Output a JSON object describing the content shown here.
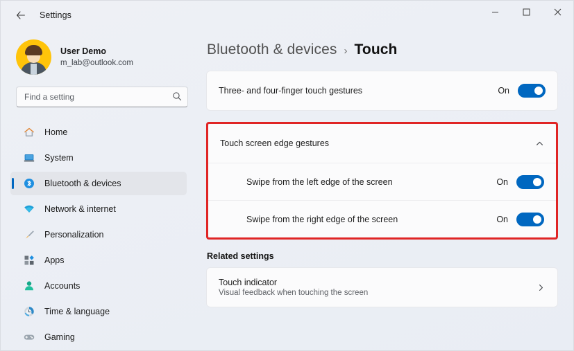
{
  "window": {
    "app_title": "Settings",
    "back_icon": "back-arrow-icon",
    "minimize_label": "—",
    "maximize_label": "□",
    "close_label": "✕"
  },
  "sidebar": {
    "profile": {
      "name": "User Demo",
      "email": "m_lab@outlook.com"
    },
    "search": {
      "placeholder": "Find a setting",
      "value": ""
    },
    "items": [
      {
        "label": "Home",
        "icon": "home-icon",
        "active": false
      },
      {
        "label": "System",
        "icon": "system-icon",
        "active": false
      },
      {
        "label": "Bluetooth & devices",
        "icon": "bluetooth-icon",
        "active": true
      },
      {
        "label": "Network & internet",
        "icon": "network-icon",
        "active": false
      },
      {
        "label": "Personalization",
        "icon": "brush-icon",
        "active": false
      },
      {
        "label": "Apps",
        "icon": "apps-icon",
        "active": false
      },
      {
        "label": "Accounts",
        "icon": "accounts-icon",
        "active": false
      },
      {
        "label": "Time & language",
        "icon": "clock-icon",
        "active": false
      },
      {
        "label": "Gaming",
        "icon": "gamepad-icon",
        "active": false
      }
    ]
  },
  "content": {
    "breadcrumb": {
      "parent": "Bluetooth & devices",
      "separator": "›",
      "current": "Touch"
    },
    "three_four_finger": {
      "label": "Three- and four-finger touch gestures",
      "state": "On"
    },
    "edge_gestures": {
      "title": "Touch screen edge gestures",
      "expand_icon": "chevron-up-icon",
      "rows": [
        {
          "label": "Swipe from the left edge of the screen",
          "state": "On"
        },
        {
          "label": "Swipe from the right edge of the screen",
          "state": "On"
        }
      ]
    },
    "related": {
      "title": "Related settings",
      "item": {
        "title": "Touch indicator",
        "subtitle": "Visual feedback when touching the screen",
        "chevron_icon": "chevron-right-icon"
      }
    }
  },
  "colors": {
    "accent": "#0067C0",
    "highlight_border": "#E02525",
    "card_bg": "#FBFBFC",
    "page_bg": "#EEF1F6"
  }
}
